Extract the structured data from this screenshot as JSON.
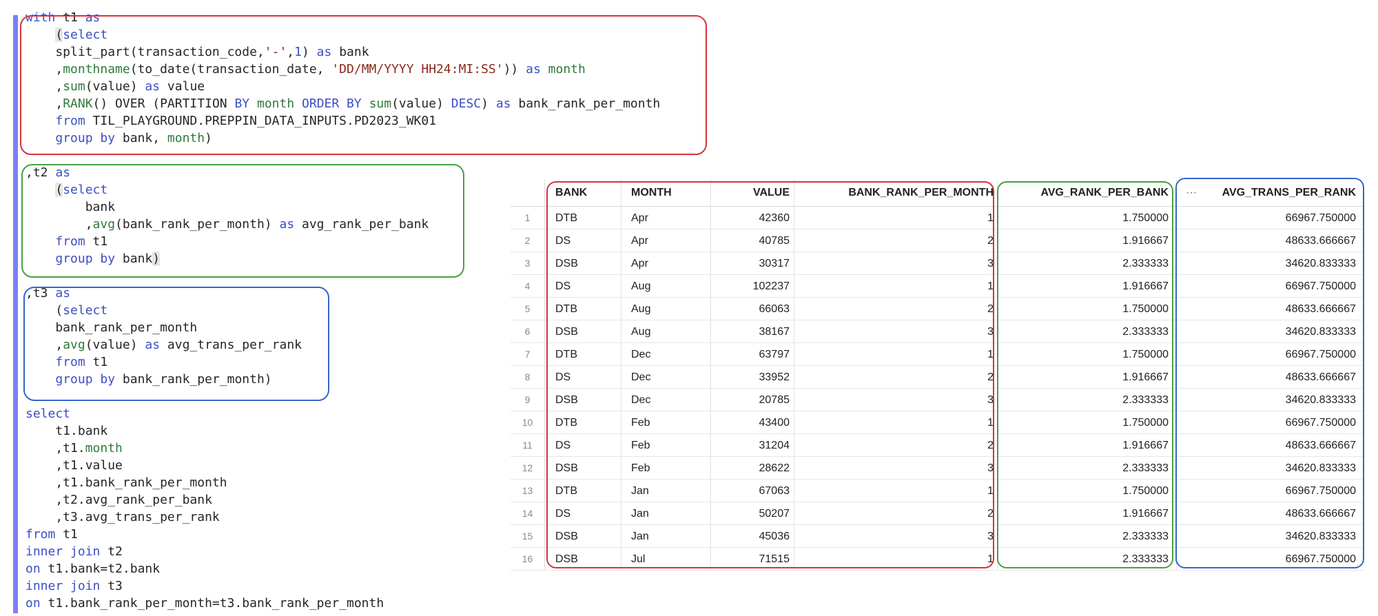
{
  "colors": {
    "gutter": "#7b7ff2",
    "keyword": "#3b4fc6",
    "function": "#2f7a3c",
    "string": "#8b2a1d",
    "box_t1": "#d6323c",
    "box_t2": "#46a040",
    "box_t3": "#3467c8"
  },
  "code": {
    "l1": [
      [
        "kw",
        "with"
      ],
      [
        "t",
        " t1 "
      ],
      [
        "kw",
        "as"
      ]
    ],
    "l2": [
      [
        "t",
        "    "
      ],
      [
        "hl",
        "("
      ],
      [
        "kw",
        "select"
      ]
    ],
    "l3": [
      [
        "t",
        "    split_part(transaction_code,"
      ],
      [
        "str",
        "'-'"
      ],
      [
        "t",
        ","
      ],
      [
        "num",
        "1"
      ],
      [
        "t",
        ") "
      ],
      [
        "kw",
        "as"
      ],
      [
        "t",
        " bank"
      ]
    ],
    "l4": [
      [
        "t",
        "    ,"
      ],
      [
        "fn",
        "monthname"
      ],
      [
        "t",
        "(to_date(transaction_date, "
      ],
      [
        "str",
        "'DD/MM/YYYY HH24:MI:SS'"
      ],
      [
        "t",
        "))"
      ],
      [
        "t",
        " "
      ],
      [
        "kw",
        "as"
      ],
      [
        "t",
        " "
      ],
      [
        "fn",
        "month"
      ]
    ],
    "l5": [
      [
        "t",
        "    ,"
      ],
      [
        "fn",
        "sum"
      ],
      [
        "t",
        "(value) "
      ],
      [
        "kw",
        "as"
      ],
      [
        "t",
        " value"
      ]
    ],
    "l6": [
      [
        "t",
        "    ,"
      ],
      [
        "fn",
        "RANK"
      ],
      [
        "t",
        "() OVER (PARTITION "
      ],
      [
        "kw",
        "BY"
      ],
      [
        "t",
        " "
      ],
      [
        "fn",
        "month"
      ],
      [
        "t",
        " "
      ],
      [
        "kw",
        "ORDER BY"
      ],
      [
        "t",
        " "
      ],
      [
        "fn",
        "sum"
      ],
      [
        "t",
        "(value) "
      ],
      [
        "kw",
        "DESC"
      ],
      [
        "t",
        ") "
      ],
      [
        "kw",
        "as"
      ],
      [
        "t",
        " bank_rank_per_month"
      ]
    ],
    "l7": [
      [
        "t",
        "    "
      ],
      [
        "kw",
        "from"
      ],
      [
        "t",
        " TIL_PLAYGROUND.PREPPIN_DATA_INPUTS.PD2023_WK01"
      ]
    ],
    "l8": [
      [
        "t",
        "    "
      ],
      [
        "kw",
        "group by"
      ],
      [
        "t",
        " bank, "
      ],
      [
        "fn",
        "month"
      ],
      [
        "t",
        ")"
      ]
    ],
    "l9": [
      [
        "t",
        ",t2 "
      ],
      [
        "kw",
        "as"
      ]
    ],
    "l10": [
      [
        "t",
        "    "
      ],
      [
        "hl",
        "("
      ],
      [
        "kw",
        "select"
      ]
    ],
    "l11": [
      [
        "t",
        "        bank"
      ]
    ],
    "l12": [
      [
        "t",
        "        ,"
      ],
      [
        "fn",
        "avg"
      ],
      [
        "t",
        "(bank_rank_per_month) "
      ],
      [
        "kw",
        "as"
      ],
      [
        "t",
        " avg_rank_per_bank"
      ]
    ],
    "l13": [
      [
        "t",
        "    "
      ],
      [
        "kw",
        "from"
      ],
      [
        "t",
        " t1"
      ]
    ],
    "l14": [
      [
        "t",
        "    "
      ],
      [
        "kw",
        "group by"
      ],
      [
        "t",
        " bank"
      ],
      [
        "hl",
        ")"
      ]
    ],
    "l15": [
      [
        "t",
        ",t3 "
      ],
      [
        "kw",
        "as"
      ]
    ],
    "l16": [
      [
        "t",
        "    ("
      ],
      [
        "kw",
        "select"
      ]
    ],
    "l17": [
      [
        "t",
        "    bank_rank_per_month"
      ]
    ],
    "l18": [
      [
        "t",
        "    ,"
      ],
      [
        "fn",
        "avg"
      ],
      [
        "t",
        "(value) "
      ],
      [
        "kw",
        "as"
      ],
      [
        "t",
        " avg_trans_per_rank"
      ]
    ],
    "l19": [
      [
        "t",
        "    "
      ],
      [
        "kw",
        "from"
      ],
      [
        "t",
        " t1"
      ]
    ],
    "l20": [
      [
        "t",
        "    "
      ],
      [
        "kw",
        "group by"
      ],
      [
        "t",
        " bank_rank_per_month)"
      ]
    ],
    "l21": [
      [
        "kw",
        "select"
      ]
    ],
    "l22": [
      [
        "t",
        "    t1.bank"
      ]
    ],
    "l23": [
      [
        "t",
        "    ,t1."
      ],
      [
        "fn",
        "month"
      ]
    ],
    "l24": [
      [
        "t",
        "    ,t1.value"
      ]
    ],
    "l25": [
      [
        "t",
        "    ,t1.bank_rank_per_month"
      ]
    ],
    "l26": [
      [
        "t",
        "    ,t2.avg_rank_per_bank"
      ]
    ],
    "l27": [
      [
        "t",
        "    ,t3.avg_trans_per_rank"
      ]
    ],
    "l28": [
      [
        "kw",
        "from"
      ],
      [
        "t",
        " t1"
      ]
    ],
    "l29": [
      [
        "kw",
        "inner join"
      ],
      [
        "t",
        " t2"
      ]
    ],
    "l30": [
      [
        "kw",
        "on"
      ],
      [
        "t",
        " t1.bank=t2.bank"
      ]
    ],
    "l31": [
      [
        "kw",
        "inner join"
      ],
      [
        "t",
        " t3"
      ]
    ],
    "l32": [
      [
        "kw",
        "on"
      ],
      [
        "t",
        " t1.bank_rank_per_month=t3.bank_rank_per_month"
      ]
    ]
  },
  "grid": {
    "columns": [
      "BANK",
      "MONTH",
      "VALUE",
      "BANK_RANK_PER_MONTH",
      "AVG_RANK_PER_BANK",
      "AVG_TRANS_PER_RANK"
    ],
    "more_icon": "···",
    "rows": [
      [
        "1",
        "DTB",
        "Apr",
        "42360",
        "1",
        "1.750000",
        "66967.750000"
      ],
      [
        "2",
        "DS",
        "Apr",
        "40785",
        "2",
        "1.916667",
        "48633.666667"
      ],
      [
        "3",
        "DSB",
        "Apr",
        "30317",
        "3",
        "2.333333",
        "34620.833333"
      ],
      [
        "4",
        "DS",
        "Aug",
        "102237",
        "1",
        "1.916667",
        "66967.750000"
      ],
      [
        "5",
        "DTB",
        "Aug",
        "66063",
        "2",
        "1.750000",
        "48633.666667"
      ],
      [
        "6",
        "DSB",
        "Aug",
        "38167",
        "3",
        "2.333333",
        "34620.833333"
      ],
      [
        "7",
        "DTB",
        "Dec",
        "63797",
        "1",
        "1.750000",
        "66967.750000"
      ],
      [
        "8",
        "DS",
        "Dec",
        "33952",
        "2",
        "1.916667",
        "48633.666667"
      ],
      [
        "9",
        "DSB",
        "Dec",
        "20785",
        "3",
        "2.333333",
        "34620.833333"
      ],
      [
        "10",
        "DTB",
        "Feb",
        "43400",
        "1",
        "1.750000",
        "66967.750000"
      ],
      [
        "11",
        "DS",
        "Feb",
        "31204",
        "2",
        "1.916667",
        "48633.666667"
      ],
      [
        "12",
        "DSB",
        "Feb",
        "28622",
        "3",
        "2.333333",
        "34620.833333"
      ],
      [
        "13",
        "DTB",
        "Jan",
        "67063",
        "1",
        "1.750000",
        "66967.750000"
      ],
      [
        "14",
        "DS",
        "Jan",
        "50207",
        "2",
        "1.916667",
        "48633.666667"
      ],
      [
        "15",
        "DSB",
        "Jan",
        "45036",
        "3",
        "2.333333",
        "34620.833333"
      ],
      [
        "16",
        "DSB",
        "Jul",
        "71515",
        "1",
        "2.333333",
        "66967.750000"
      ]
    ]
  }
}
